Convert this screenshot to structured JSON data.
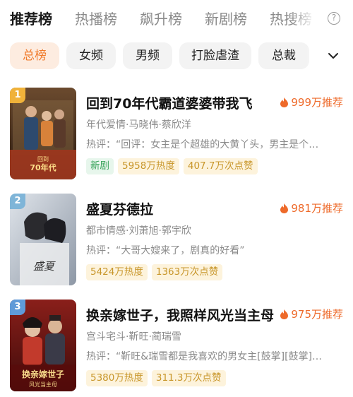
{
  "tabs": [
    {
      "label": "推荐榜",
      "active": true
    },
    {
      "label": "热播榜",
      "active": false
    },
    {
      "label": "飙升榜",
      "active": false
    },
    {
      "label": "新剧榜",
      "active": false
    },
    {
      "label": "热搜榜",
      "active": false
    }
  ],
  "help_icon": "question-circle-icon",
  "chips": [
    {
      "label": "总榜",
      "active": true
    },
    {
      "label": "女频",
      "active": false
    },
    {
      "label": "男频",
      "active": false
    },
    {
      "label": "打脸虐渣",
      "active": false
    },
    {
      "label": "总裁",
      "active": false
    }
  ],
  "expand_icon": "chevron-down-icon",
  "colors": {
    "accent": "#ee6a2a",
    "chip_active_bg": "#fdece0",
    "new_badge": "#3aa45b",
    "heat_badge": "#c8962a"
  },
  "items": [
    {
      "rank": "1",
      "rank_color": "#f0b23a",
      "title": "回到70年代霸道婆婆带我飞",
      "recommend": "999万推荐",
      "meta": "年代爱情·马晓伟·蔡欣洋",
      "review": "热评：“回评：女主是个超雄的大黄丫头，男主是个…",
      "badges": [
        {
          "text": "新剧",
          "type": "new"
        },
        {
          "text": "5958万热度",
          "type": "heat"
        },
        {
          "text": "407.7万次点赞",
          "type": "heat"
        }
      ]
    },
    {
      "rank": "2",
      "rank_color": "#7fb5d8",
      "title": "盛夏芬德拉",
      "recommend": "981万推荐",
      "meta": "都市情感·刘萧旭·郭宇欣",
      "review": "热评：“大哥大嫂来了，剧真的好看”",
      "badges": [
        {
          "text": "5424万热度",
          "type": "heat"
        },
        {
          "text": "1363万次点赞",
          "type": "heat"
        }
      ]
    },
    {
      "rank": "3",
      "rank_color": "#5f9ad8",
      "title": "换亲嫁世子，我照样风光当主母",
      "recommend": "975万推荐",
      "meta": "宫斗宅斗·靳旺·蔺瑞雪",
      "review": "热评：“靳旺&瑞雪都是我喜欢的男女主[鼓掌][鼓掌]…",
      "badges": [
        {
          "text": "5380万热度",
          "type": "heat"
        },
        {
          "text": "311.3万次点赞",
          "type": "heat"
        }
      ]
    }
  ]
}
